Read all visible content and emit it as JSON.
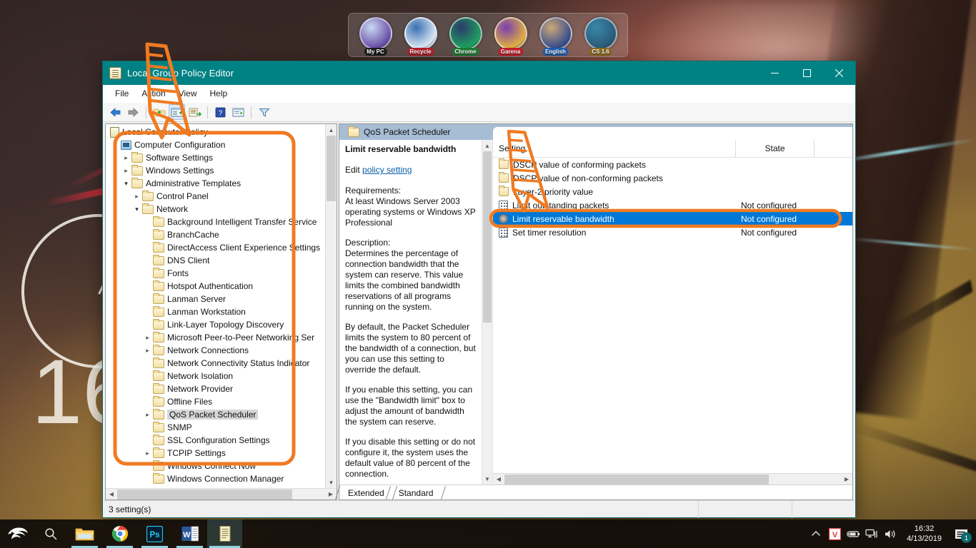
{
  "desktop": {
    "clock_widget": {
      "hour_digits": "16"
    },
    "dock": {
      "items": [
        {
          "label": "My PC",
          "icon": "mypc-icon",
          "label_bg": "#1d1d1d",
          "art1": "#c9d9f2",
          "art2": "#6a4fa8"
        },
        {
          "label": "Recycle",
          "icon": "recycle-bin-icon",
          "label_bg": "#b0202c",
          "art1": "#3a6fb0",
          "art2": "#d8e6f5"
        },
        {
          "label": "Chrome",
          "icon": "chrome-icon",
          "label_bg": "#1f7a33",
          "art1": "#2a3a6a",
          "art2": "#20a060"
        },
        {
          "label": "Garena",
          "icon": "garena-icon",
          "label_bg": "#c41e2a",
          "art1": "#7a3fb0",
          "art2": "#e0b040"
        },
        {
          "label": "English",
          "icon": "english-icon",
          "label_bg": "#1f5fb0",
          "art1": "#caa87a",
          "art2": "#3a4f8a"
        },
        {
          "label": "CS 1.6",
          "icon": "cs16-icon",
          "label_bg": "#8a6a20",
          "art1": "#3a86a8",
          "art2": "#2a5a78"
        }
      ]
    }
  },
  "window": {
    "title": "Local Group Policy Editor",
    "title_icon": "policy-document-icon",
    "controls": {
      "minimize": "—",
      "maximize": "☐",
      "close": "✕"
    },
    "menu": [
      "File",
      "Action",
      "View",
      "Help"
    ],
    "toolbar_icons": [
      "back-arrow-icon",
      "forward-arrow-icon",
      "up-folder-icon",
      "show-hide-tree-icon",
      "export-list-icon",
      "help-icon",
      "properties-icon",
      "filter-icon"
    ]
  },
  "tree": {
    "root": {
      "label": "Local Computer Policy",
      "icon": "policy-document-icon"
    },
    "nodes": [
      {
        "label": "Computer Configuration",
        "indent": 0,
        "chev": "down",
        "icon": "computer-icon"
      },
      {
        "label": "Software Settings",
        "indent": 1,
        "chev": "right",
        "icon": "folder-icon"
      },
      {
        "label": "Windows Settings",
        "indent": 1,
        "chev": "right",
        "icon": "folder-icon"
      },
      {
        "label": "Administrative Templates",
        "indent": 1,
        "chev": "down",
        "icon": "folder-icon"
      },
      {
        "label": "Control Panel",
        "indent": 2,
        "chev": "right",
        "icon": "folder-icon"
      },
      {
        "label": "Network",
        "indent": 2,
        "chev": "down",
        "icon": "folder-icon"
      },
      {
        "label": "Background Intelligent Transfer Service",
        "indent": 3,
        "chev": "",
        "icon": "folder-icon"
      },
      {
        "label": "BranchCache",
        "indent": 3,
        "chev": "",
        "icon": "folder-icon"
      },
      {
        "label": "DirectAccess Client Experience Settings",
        "indent": 3,
        "chev": "",
        "icon": "folder-icon"
      },
      {
        "label": "DNS Client",
        "indent": 3,
        "chev": "",
        "icon": "folder-icon"
      },
      {
        "label": "Fonts",
        "indent": 3,
        "chev": "",
        "icon": "folder-icon"
      },
      {
        "label": "Hotspot Authentication",
        "indent": 3,
        "chev": "",
        "icon": "folder-icon"
      },
      {
        "label": "Lanman Server",
        "indent": 3,
        "chev": "",
        "icon": "folder-icon"
      },
      {
        "label": "Lanman Workstation",
        "indent": 3,
        "chev": "",
        "icon": "folder-icon"
      },
      {
        "label": "Link-Layer Topology Discovery",
        "indent": 3,
        "chev": "",
        "icon": "folder-icon"
      },
      {
        "label": "Microsoft Peer-to-Peer Networking Ser",
        "indent": 3,
        "chev": "right",
        "icon": "folder-icon"
      },
      {
        "label": "Network Connections",
        "indent": 3,
        "chev": "right",
        "icon": "folder-icon"
      },
      {
        "label": "Network Connectivity Status Indicator",
        "indent": 3,
        "chev": "",
        "icon": "folder-icon"
      },
      {
        "label": "Network Isolation",
        "indent": 3,
        "chev": "",
        "icon": "folder-icon"
      },
      {
        "label": "Network Provider",
        "indent": 3,
        "chev": "",
        "icon": "folder-icon"
      },
      {
        "label": "Offline Files",
        "indent": 3,
        "chev": "",
        "icon": "folder-icon"
      },
      {
        "label": "QoS Packet Scheduler",
        "indent": 3,
        "chev": "right",
        "icon": "folder-icon",
        "selected": true
      },
      {
        "label": "SNMP",
        "indent": 3,
        "chev": "",
        "icon": "folder-icon"
      },
      {
        "label": "SSL Configuration Settings",
        "indent": 3,
        "chev": "",
        "icon": "folder-icon"
      },
      {
        "label": "TCPIP Settings",
        "indent": 3,
        "chev": "right",
        "icon": "folder-icon"
      },
      {
        "label": "Windows Connect Now",
        "indent": 3,
        "chev": "",
        "icon": "folder-icon"
      },
      {
        "label": "Windows Connection Manager",
        "indent": 3,
        "chev": "",
        "icon": "folder-icon"
      }
    ]
  },
  "details": {
    "tab_label": "QoS Packet Scheduler",
    "tab_icon": "folder-icon",
    "policy_title": "Limit reservable bandwidth",
    "edit_prefix": "Edit ",
    "edit_link": "policy setting",
    "requirements_label": "Requirements:",
    "requirements_text": "At least Windows Server 2003 operating systems or Windows XP Professional",
    "description_label": "Description:",
    "description_paragraphs": [
      "Determines the percentage of connection bandwidth that the system can reserve. This value limits the combined bandwidth reservations of all programs running on the system.",
      "By default, the Packet Scheduler limits the system to 80 percent of the bandwidth of a connection, but you can use this setting to override the default.",
      "If you enable this setting, you can use the \"Bandwidth limit\" box to adjust the amount of bandwidth the system can reserve.",
      "If you disable this setting or do not configure it, the system uses the default value of 80 percent of the connection."
    ]
  },
  "settings_list": {
    "columns": [
      "Setting",
      "State",
      ""
    ],
    "rows": [
      {
        "name": "DSCP value of conforming packets",
        "state": "",
        "icon": "folder-icon"
      },
      {
        "name": "DSCP value of non-conforming packets",
        "state": "",
        "icon": "folder-icon"
      },
      {
        "name": "Layer-2 priority value",
        "state": "",
        "icon": "folder-icon"
      },
      {
        "name": "Limit outstanding packets",
        "state": "Not configured",
        "icon": "policy-setting-icon"
      },
      {
        "name": "Limit reservable bandwidth",
        "state": "Not configured",
        "icon": "policy-setting-icon",
        "selected": true
      },
      {
        "name": "Set timer resolution",
        "state": "Not configured",
        "icon": "policy-setting-icon"
      }
    ]
  },
  "view_tabs": [
    {
      "label": "Extended",
      "active": false
    },
    {
      "label": "Standard",
      "active": true
    }
  ],
  "statusbar": {
    "text": "3 setting(s)"
  },
  "taskbar": {
    "start_icon": "kali-dragon-icon",
    "search_icon": "search-icon",
    "apps": [
      {
        "name": "file-explorer",
        "icon": "file-explorer-icon",
        "running": true,
        "active": false
      },
      {
        "name": "chrome",
        "icon": "chrome-icon",
        "running": true,
        "active": false
      },
      {
        "name": "photoshop",
        "icon": "photoshop-icon",
        "running": true,
        "active": false
      },
      {
        "name": "word",
        "icon": "word-icon",
        "running": true,
        "active": false
      },
      {
        "name": "group-policy-editor",
        "icon": "policy-document-icon",
        "running": true,
        "active": true
      }
    ],
    "tray": [
      {
        "name": "show-hidden-icons",
        "glyph": "∧"
      },
      {
        "name": "vlc-icon",
        "glyph": "V"
      },
      {
        "name": "battery-icon",
        "glyph": "▭"
      },
      {
        "name": "network-icon",
        "glyph": "⎙"
      },
      {
        "name": "volume-icon",
        "glyph": "🔊"
      }
    ],
    "clock": {
      "time": "16:32",
      "date": "4/13/2019"
    },
    "action_center": {
      "icon": "action-center-icon",
      "badge": "1"
    }
  },
  "annotations": {
    "color": "#f07a22",
    "arrow_1": "points-to-show-hide-tree-toolbar-button",
    "arrow_2": "points-to-limit-reservable-bandwidth-row",
    "box_1": "highlights-computer-configuration-tree-branch",
    "box_2": "highlights-selected-limit-reservable-bandwidth-row"
  }
}
